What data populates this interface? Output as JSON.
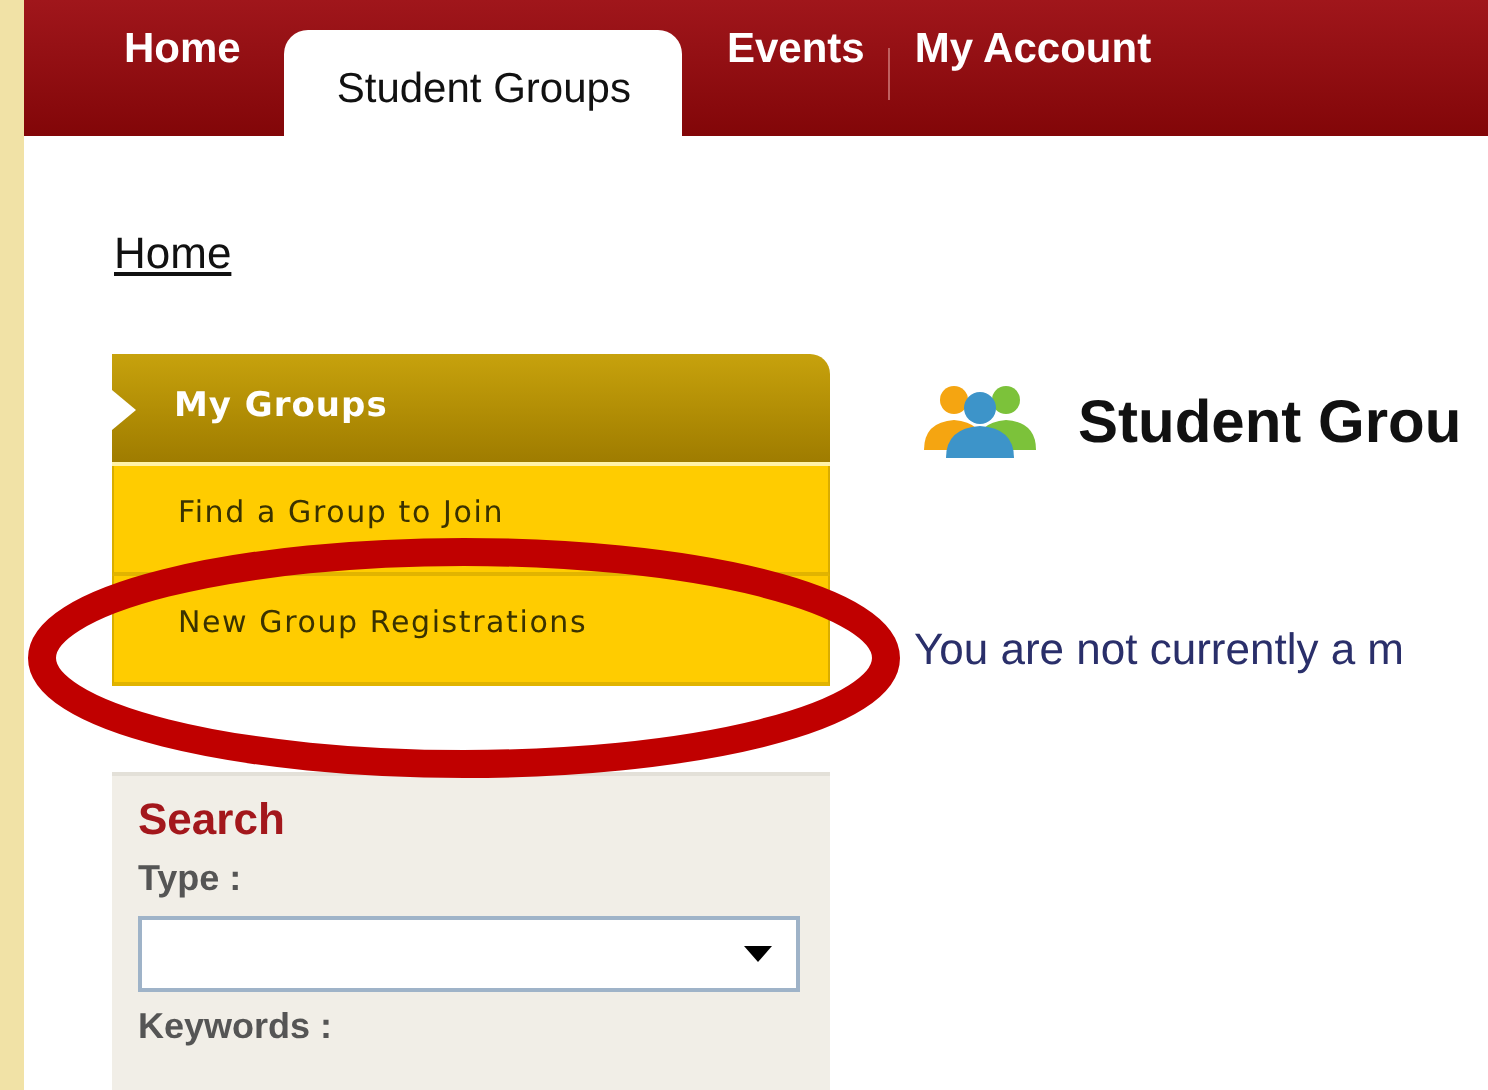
{
  "nav": {
    "tabs": [
      {
        "label": "Home",
        "selected": false
      },
      {
        "label": "Student Groups",
        "selected": true
      },
      {
        "label": "Events",
        "selected": false
      },
      {
        "label": "My Account",
        "selected": false
      }
    ]
  },
  "breadcrumb": "Home",
  "sidebar": {
    "menu_title": "My Groups",
    "items": [
      {
        "label": "Find a Group to Join"
      },
      {
        "label": "New Group Registrations"
      }
    ],
    "search": {
      "title": "Search",
      "type_label": "Type :",
      "keywords_label": "Keywords :"
    }
  },
  "main": {
    "title": "Student Grou",
    "message": "You are not currently a m"
  }
}
